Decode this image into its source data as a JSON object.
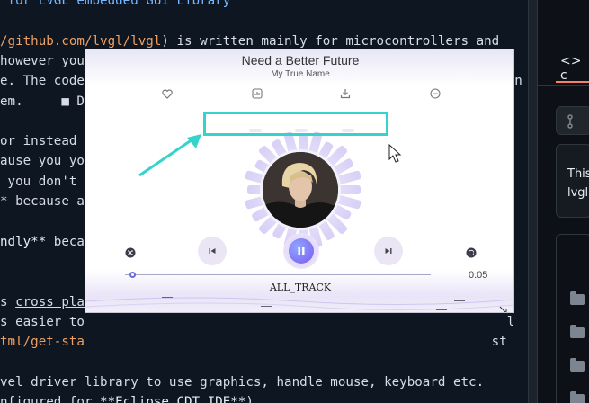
{
  "editor": {
    "lines": [
      {
        "parts": [
          {
            "t": " for LVGL embedded GUI Library",
            "c": "heading"
          }
        ]
      },
      {
        "parts": [
          {
            "t": ""
          }
        ]
      },
      {
        "parts": [
          {
            "t": "/github.com/lvgl/lvgl",
            "c": "link"
          },
          {
            "t": ") is written mainly for microcontrollers and"
          }
        ]
      },
      {
        "parts": [
          {
            "t": "however you                 the lib              PC    all with t"
          }
        ]
      },
      {
        "parts": [
          {
            "t": "e. The code                                                       in"
          }
        ]
      },
      {
        "parts": [
          {
            "t": "em.     ■ D"
          }
        ]
      },
      {
        "parts": [
          {
            "t": ""
          }
        ]
      },
      {
        "parts": [
          {
            "t": "or instead"
          }
        ]
      },
      {
        "parts": [
          {
            "t": "ause "
          },
          {
            "t": "you yo",
            "c": "ul"
          },
          {
            "t": "                                                    :"
          }
        ]
      },
      {
        "parts": [
          {
            "t": " you don't                                                       ea"
          }
        ]
      },
      {
        "parts": [
          {
            "t": "* because a                                                       e"
          }
        ]
      },
      {
        "parts": [
          {
            "t": ""
          }
        ]
      },
      {
        "parts": [
          {
            "t": "ndly**",
            "c": "bold"
          },
          {
            "t": " beca"
          }
        ]
      },
      {
        "parts": [
          {
            "t": ""
          }
        ]
      },
      {
        "parts": [
          {
            "t": ""
          }
        ]
      },
      {
        "parts": [
          {
            "t": "s "
          },
          {
            "t": "cross pla",
            "c": "ul"
          },
          {
            "t": "                                                      ve"
          }
        ]
      },
      {
        "parts": [
          {
            "t": "s easier to                                                       l"
          }
        ]
      },
      {
        "parts": [
          {
            "t": "tml/get-sta",
            "c": "link"
          },
          {
            "t": "                                                     st"
          }
        ]
      },
      {
        "parts": [
          {
            "t": ""
          }
        ]
      },
      {
        "parts": [
          {
            "t": "vel driver library to use graphics, handle mouse, keyboard etc."
          }
        ]
      },
      {
        "parts": [
          {
            "t": "nfigured for "
          },
          {
            "t": "**Eclipse CDT IDE**",
            "c": "bold"
          },
          {
            "t": ")"
          }
        ]
      }
    ]
  },
  "right_panel": {
    "tab_label": "c",
    "about_lines": [
      "This",
      "lvgl"
    ]
  },
  "player": {
    "title": "Need a Better Future",
    "artist": "My True Name",
    "time": "0:05",
    "track_label": "ALL_TRACK",
    "progress_fraction": 0.02
  },
  "colors": {
    "highlight": "#36d3cd",
    "play_button": "#7a6cf0",
    "link": "#f0a060"
  }
}
